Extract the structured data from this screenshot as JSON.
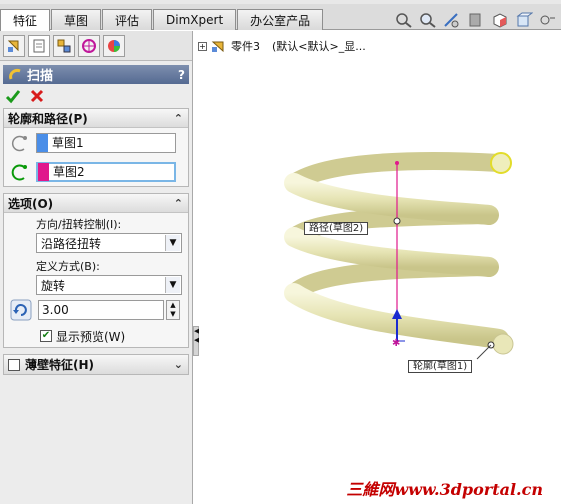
{
  "tabs": [
    {
      "label": "特征",
      "active": true
    },
    {
      "label": "草图",
      "active": false
    },
    {
      "label": "评估",
      "active": false
    },
    {
      "label": "DimXpert",
      "active": false
    },
    {
      "label": "办公室产品",
      "active": false
    }
  ],
  "toolbar_icons": [
    "zoom-fit-icon",
    "zoom-area-icon",
    "section-view-icon",
    "view-orientation-icon",
    "display-style-icon",
    "hide-show-icon",
    "appearance-icon"
  ],
  "panel_tabs": [
    "feature-manager-icon",
    "property-manager-icon",
    "configuration-manager-icon",
    "dimxpert-manager-icon",
    "display-manager-icon"
  ],
  "property_manager": {
    "title": "扫描",
    "help": "?",
    "profile_path": {
      "header": "轮廓和路径(P)",
      "profile_value": "草图1",
      "path_value": "草图2"
    },
    "options": {
      "header": "选项(O)",
      "orientation_label": "方向/扭转控制(I):",
      "orientation_value": "沿路径扭转",
      "define_label": "定义方式(B):",
      "define_value": "旋转",
      "turns_value": "3.00",
      "preview_label": "显示预览(W)",
      "preview_checked": true
    },
    "thin_feature": {
      "header": "薄壁特征(H)",
      "checked": false
    }
  },
  "tree": {
    "part_name": "零件3",
    "config": "(默认<默认>_显..."
  },
  "callouts": {
    "path": "路径(草图2)",
    "profile": "轮廓(草图1)"
  },
  "watermark": "三維网www.3dportal.cn",
  "colors": {
    "accent_header": "#5a6e96",
    "coil": "#ecebc0",
    "path_line": "#e0188c",
    "selection_highlight": "#7ab6e6"
  }
}
